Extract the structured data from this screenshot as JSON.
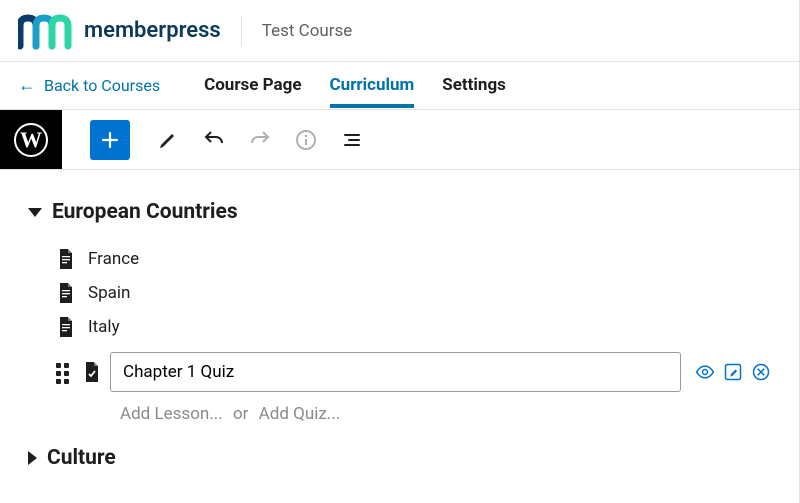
{
  "brand": {
    "name": "memberpress"
  },
  "course": {
    "title": "Test Course"
  },
  "nav": {
    "back": "Back to Courses",
    "tabs": {
      "coursePage": "Course Page",
      "curriculum": "Curriculum",
      "settings": "Settings"
    }
  },
  "sections": {
    "s1": {
      "title": "European Countries",
      "lessons": {
        "l1": "France",
        "l2": "Spain",
        "l3": "Italy"
      },
      "quizInput": {
        "value": "Chapter 1 Quiz"
      },
      "addLesson": "Add Lesson...",
      "addSep": "or",
      "addQuiz": "Add Quiz..."
    },
    "s2": {
      "title": "Culture"
    }
  }
}
